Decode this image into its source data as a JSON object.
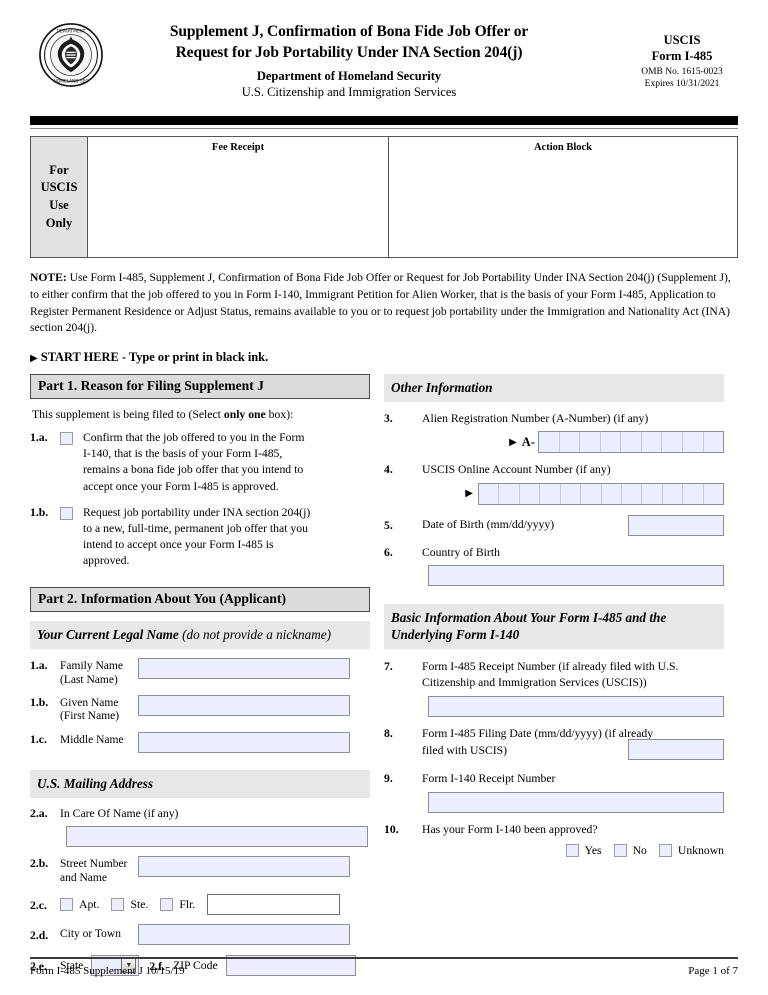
{
  "header": {
    "title_line_1": "Supplement J, Confirmation of Bona Fide Job Offer or",
    "title_line_2": "Request for Job Portability Under INA Section 204(j)",
    "agency_line_1": "Department of Homeland Security",
    "agency_line_2": "U.S. Citizenship and Immigration Services",
    "seal_alt": "dhs-seal",
    "right_block": {
      "line_1": "USCIS",
      "line_2": "Form I-485",
      "line_3": "OMB No. 1615-0023",
      "line_4": "Expires 10/31/2021"
    }
  },
  "uscis_use_only": {
    "side_label_lines": [
      "For",
      "USCIS",
      "Use",
      "Only"
    ],
    "fee_receipt_label": "Fee Receipt",
    "action_block_label": "Action Block"
  },
  "note": {
    "prefix": "NOTE:",
    "body": "  Use Form I-485, Supplement J, Confirmation of Bona Fide Job Offer or Request for Job Portability Under INA Section 204(j) (Supplement J), to either confirm that the job offered to you in Form I-140, Immigrant Petition for Alien Worker, that is the basis of your Form I-485, Application to Register Permanent Residence or Adjust Status, remains available to you or to request job portability under the Immigration and Nationality Act (INA) section 204(j)."
  },
  "start_here": {
    "marker": "▶",
    "text": "START HERE - Type or print in black ink."
  },
  "part1": {
    "header": "Part 1.  Reason for Filing Supplement J",
    "intro_prefix": "This supplement is being filed to (Select ",
    "intro_bold": "only one",
    "intro_suffix": " box):",
    "items": [
      {
        "num": "1.a.",
        "text": "Confirm that the job offered to you in the Form I-140, that is the basis of your Form I-485, remains a bona fide job offer that you intend to accept once your Form I-485 is approved."
      },
      {
        "num": "1.b.",
        "text": "Request job portability under INA section 204(j) to a new, full-time, permanent job offer that you intend to accept once your Form I-485 is approved."
      }
    ]
  },
  "part2": {
    "header": "Part 2.  Information About You (Applicant)",
    "name_section": {
      "title_bold": "Your Current Legal Name ",
      "title_italic": "(do not provide a nickname)",
      "fields": [
        {
          "num": "1.a.",
          "label_line_1": "Family Name",
          "label_line_2": "(Last Name)",
          "value": ""
        },
        {
          "num": "1.b.",
          "label_line_1": "Given Name",
          "label_line_2": "(First Name)",
          "value": ""
        },
        {
          "num": "1.c.",
          "label_line_1": "Middle Name",
          "label_line_2": "",
          "value": ""
        }
      ]
    },
    "address_section": {
      "title": "U.S. Mailing Address",
      "in_care_of": {
        "num": "2.a.",
        "label": "In Care Of Name (if any)",
        "value": ""
      },
      "street": {
        "num": "2.b.",
        "label_line_1": "Street Number",
        "label_line_2": "and Name",
        "value": ""
      },
      "unit": {
        "num": "2.c.",
        "options": [
          "Apt.",
          "Ste.",
          "Flr."
        ],
        "value": ""
      },
      "city": {
        "num": "2.d.",
        "label": "City or Town",
        "value": ""
      },
      "state": {
        "num": "2.e.",
        "label": "State",
        "value": ""
      },
      "zip": {
        "num": "2.f.",
        "label": "ZIP Code",
        "value": ""
      }
    }
  },
  "other_information": {
    "header": "Other Information",
    "a_number": {
      "num": "3.",
      "label": "Alien Registration Number (A-Number) (if any)",
      "marker": "▶",
      "prefix": "A-",
      "cell_count": 9,
      "value": ""
    },
    "online_account": {
      "num": "4.",
      "label": "USCIS Online Account Number (if any)",
      "marker": "▶",
      "cell_count": 12,
      "value": ""
    },
    "date_of_birth": {
      "num": "5.",
      "label": "Date of Birth (mm/dd/yyyy)",
      "value": ""
    },
    "country_of_birth": {
      "num": "6.",
      "label": "Country of Birth",
      "value": ""
    }
  },
  "basic_information": {
    "header_line_1": "Basic Information About Your Form I-485 and the",
    "header_line_2": "Underlying Form I-140",
    "items": [
      {
        "num": "7.",
        "label": "Form I-485 Receipt Number (if already filed with U.S. Citizenship and Immigration Services (USCIS))",
        "value": ""
      },
      {
        "num": "8.",
        "label": "Form I-485 Filing Date (mm/dd/yyyy) (if already filed with USCIS)",
        "value": ""
      },
      {
        "num": "9.",
        "label": "Form I-140 Receipt Number",
        "value": ""
      },
      {
        "num": "10.",
        "label": "Has your Form I-140 been approved?",
        "choices": [
          "Yes",
          "No",
          "Unknown"
        ]
      }
    ]
  },
  "footer": {
    "left": "Form I-485 Supplement J   10/15/19",
    "right": "Page 1 of 7"
  },
  "colors": {
    "field_fill": "#eceffb",
    "field_border": "#8f8f9c",
    "part_header_bg": "#dcdcdc",
    "sub_header_bg": "#e7e7e7",
    "use_only_bg": "#e1e1e1"
  }
}
